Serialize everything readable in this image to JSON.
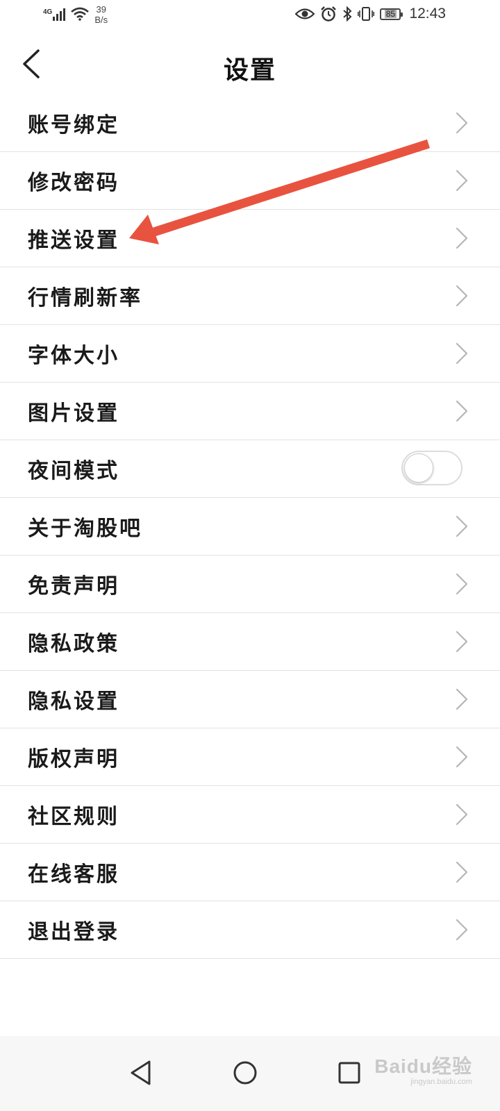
{
  "status_bar": {
    "network": "4G",
    "speed_value": "39",
    "speed_unit": "B/s",
    "battery": "85",
    "time": "12:43",
    "icons": [
      "signal-icon",
      "wifi-icon",
      "eye-icon",
      "alarm-icon",
      "bluetooth-icon",
      "vibrate-icon",
      "battery-icon"
    ]
  },
  "header": {
    "title": "设置",
    "back_icon": "chevron-left-icon"
  },
  "settings_items": [
    {
      "label": "账号绑定",
      "control": "chevron"
    },
    {
      "label": "修改密码",
      "control": "chevron"
    },
    {
      "label": "推送设置",
      "control": "chevron"
    },
    {
      "label": "行情刷新率",
      "control": "chevron"
    },
    {
      "label": "字体大小",
      "control": "chevron"
    },
    {
      "label": "图片设置",
      "control": "chevron"
    },
    {
      "label": "夜间模式",
      "control": "toggle",
      "toggle_on": false
    },
    {
      "label": "关于淘股吧",
      "control": "chevron"
    },
    {
      "label": "免责声明",
      "control": "chevron"
    },
    {
      "label": "隐私政策",
      "control": "chevron"
    },
    {
      "label": "隐私设置",
      "control": "chevron"
    },
    {
      "label": "版权声明",
      "control": "chevron"
    },
    {
      "label": "社区规则",
      "control": "chevron"
    },
    {
      "label": "在线客服",
      "control": "chevron"
    },
    {
      "label": "退出登录",
      "control": "chevron"
    }
  ],
  "annotation": {
    "type": "arrow",
    "color": "#e8533f",
    "points_to": "推送设置"
  },
  "nav_bar": {
    "icons": [
      "back-triangle-icon",
      "home-circle-icon",
      "recents-square-icon"
    ]
  },
  "watermark": {
    "main": "Baidu经验",
    "sub": "jingyan.baidu.com"
  }
}
